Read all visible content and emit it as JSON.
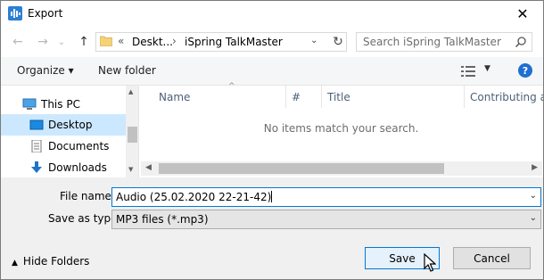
{
  "window": {
    "title": "Export",
    "close_glyph": "✕"
  },
  "nav": {
    "back_glyph": "←",
    "forward_glyph": "→",
    "recent_glyph": "⌄",
    "up_glyph": "↑",
    "breadcrumb": {
      "overflow": "«",
      "items": [
        "Deskt...",
        "iSpring TalkMaster"
      ],
      "separator": "›"
    },
    "dropdown_glyph": "⌄",
    "refresh_glyph": "↻",
    "search_placeholder": "Search iSpring TalkMaster"
  },
  "commandbar": {
    "organize_label": "Organize ▾",
    "new_folder_label": "New folder",
    "view_dropdown_glyph": "▼",
    "help_label": "?"
  },
  "navpane": {
    "items": [
      {
        "label": "This PC",
        "icon": "computer-icon"
      },
      {
        "label": "Desktop",
        "icon": "desktop-icon",
        "selected": true
      },
      {
        "label": "Documents",
        "icon": "documents-icon"
      },
      {
        "label": "Downloads",
        "icon": "downloads-icon"
      }
    ],
    "scroll_up_glyph": "▲",
    "scroll_down_glyph": "▼"
  },
  "filelist": {
    "columns": [
      "Name",
      "#",
      "Title",
      "Contributing art"
    ],
    "sort_glyph": "^",
    "empty_message": "No items match your search.",
    "scroll_left_glyph": "◀",
    "scroll_right_glyph": "▶"
  },
  "form": {
    "file_name_label": "File name:",
    "file_name_value": "Audio (25.02.2020 22-21-42)",
    "save_as_type_label": "Save as type:",
    "save_as_type_value": "MP3 files (*.mp3)",
    "dropdown_glyph": "⌄"
  },
  "footer": {
    "hide_folders_chevron": "▲",
    "hide_folders_label": "Hide Folders",
    "save_label": "Save",
    "cancel_label": "Cancel"
  },
  "colors": {
    "accent": "#0078d7",
    "selection": "#cce8ff",
    "help": "#1e6fd1"
  }
}
